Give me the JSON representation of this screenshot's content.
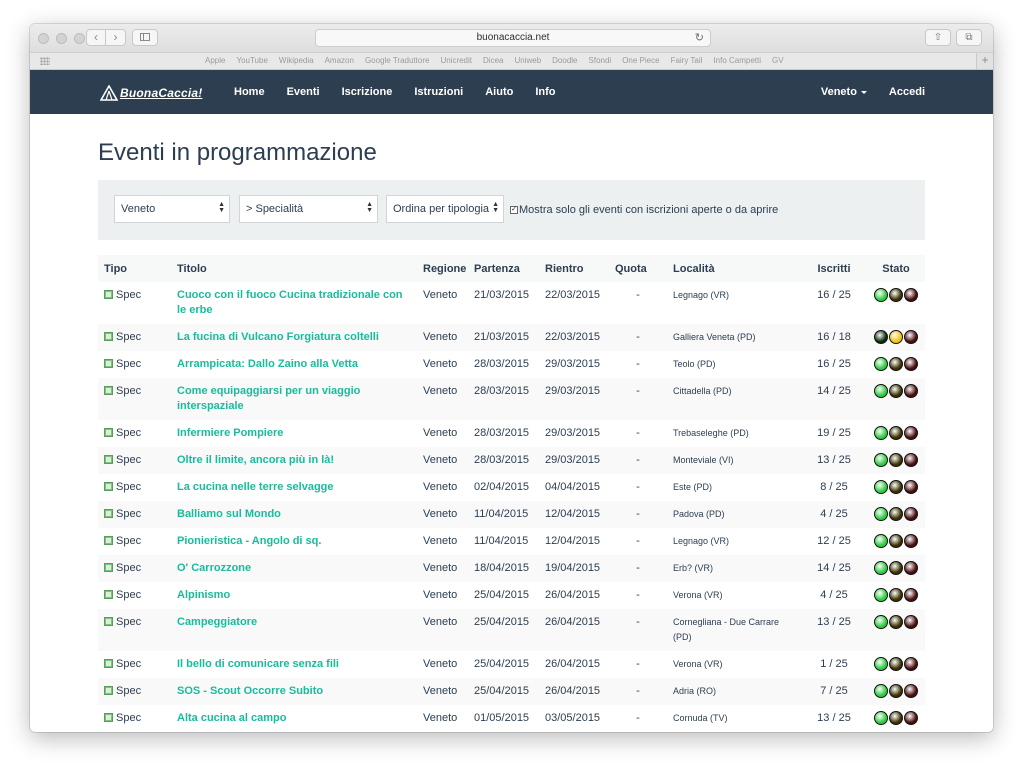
{
  "browser": {
    "url": "buonacaccia.net",
    "bookmarks": [
      "Apple",
      "YouTube",
      "Wikipedia",
      "Amazon",
      "Google Traduttore",
      "Unicredit",
      "Dicea",
      "Uniweb",
      "Doodle",
      "Sfondi",
      "One Piece",
      "Fairy Tail",
      "Info Campetti",
      "GV"
    ]
  },
  "site": {
    "logo": "BuonaCaccia!",
    "nav": [
      "Home",
      "Eventi",
      "Iscrizione",
      "Istruzioni",
      "Aiuto",
      "Info"
    ],
    "region_menu": "Veneto",
    "login": "Accedi"
  },
  "page": {
    "title": "Eventi in programmazione",
    "filters": {
      "region": "Veneto",
      "specialty": "> Specialità",
      "order": "Ordina per tipologia",
      "checkbox_label": "Mostra solo gli eventi con iscrizioni aperte o da aprire",
      "checkbox_checked": true
    },
    "columns": [
      "Tipo",
      "Titolo",
      "Regione",
      "Partenza",
      "Rientro",
      "Quota",
      "Località",
      "Iscritti",
      "Stato"
    ],
    "rows": [
      {
        "tipo": "Spec",
        "titolo": "Cuoco con il fuoco Cucina tradizionale con le erbe",
        "regione": "Veneto",
        "partenza": "21/03/2015",
        "rientro": "22/03/2015",
        "quota": "-",
        "localita": "Legnago (VR)",
        "iscritti": "16 / 25",
        "stato": "green"
      },
      {
        "tipo": "Spec",
        "titolo": "La fucina di Vulcano Forgiatura coltelli",
        "regione": "Veneto",
        "partenza": "21/03/2015",
        "rientro": "22/03/2015",
        "quota": "-",
        "localita": "Galliera Veneta (PD)",
        "iscritti": "16 / 18",
        "stato": "yellow"
      },
      {
        "tipo": "Spec",
        "titolo": "Arrampicata: Dallo Zaino alla Vetta",
        "regione": "Veneto",
        "partenza": "28/03/2015",
        "rientro": "29/03/2015",
        "quota": "-",
        "localita": "Teolo (PD)",
        "iscritti": "16 / 25",
        "stato": "green"
      },
      {
        "tipo": "Spec",
        "titolo": "Come equipaggiarsi per un viaggio interspaziale",
        "regione": "Veneto",
        "partenza": "28/03/2015",
        "rientro": "29/03/2015",
        "quota": "-",
        "localita": "Cittadella (PD)",
        "iscritti": "14 / 25",
        "stato": "green"
      },
      {
        "tipo": "Spec",
        "titolo": "Infermiere Pompiere",
        "regione": "Veneto",
        "partenza": "28/03/2015",
        "rientro": "29/03/2015",
        "quota": "-",
        "localita": "Trebaseleghe (PD)",
        "iscritti": "19 / 25",
        "stato": "green"
      },
      {
        "tipo": "Spec",
        "titolo": "Oltre il limite, ancora più in là!",
        "regione": "Veneto",
        "partenza": "28/03/2015",
        "rientro": "29/03/2015",
        "quota": "-",
        "localita": "Monteviale (VI)",
        "iscritti": "13 / 25",
        "stato": "green"
      },
      {
        "tipo": "Spec",
        "titolo": "La cucina nelle terre selvagge",
        "regione": "Veneto",
        "partenza": "02/04/2015",
        "rientro": "04/04/2015",
        "quota": "-",
        "localita": "Este (PD)",
        "iscritti": "8 / 25",
        "stato": "green"
      },
      {
        "tipo": "Spec",
        "titolo": "Balliamo sul Mondo",
        "regione": "Veneto",
        "partenza": "11/04/2015",
        "rientro": "12/04/2015",
        "quota": "-",
        "localita": "Padova (PD)",
        "iscritti": "4 / 25",
        "stato": "green"
      },
      {
        "tipo": "Spec",
        "titolo": "Pionieristica - Angolo di sq.",
        "regione": "Veneto",
        "partenza": "11/04/2015",
        "rientro": "12/04/2015",
        "quota": "-",
        "localita": "Legnago (VR)",
        "iscritti": "12 / 25",
        "stato": "green"
      },
      {
        "tipo": "Spec",
        "titolo": "O' Carrozzone",
        "regione": "Veneto",
        "partenza": "18/04/2015",
        "rientro": "19/04/2015",
        "quota": "-",
        "localita": "Erb? (VR)",
        "iscritti": "14 / 25",
        "stato": "green"
      },
      {
        "tipo": "Spec",
        "titolo": "Alpinismo",
        "regione": "Veneto",
        "partenza": "25/04/2015",
        "rientro": "26/04/2015",
        "quota": "-",
        "localita": "Verona (VR)",
        "iscritti": "4 / 25",
        "stato": "green"
      },
      {
        "tipo": "Spec",
        "titolo": "Campeggiatore",
        "regione": "Veneto",
        "partenza": "25/04/2015",
        "rientro": "26/04/2015",
        "quota": "-",
        "localita": "Cornegliana - Due Carrare (PD)",
        "iscritti": "13 / 25",
        "stato": "green"
      },
      {
        "tipo": "Spec",
        "titolo": "Il bello di comunicare senza fili",
        "regione": "Veneto",
        "partenza": "25/04/2015",
        "rientro": "26/04/2015",
        "quota": "-",
        "localita": "Verona (VR)",
        "iscritti": "1 / 25",
        "stato": "green"
      },
      {
        "tipo": "Spec",
        "titolo": "SOS - Scout Occorre Subito",
        "regione": "Veneto",
        "partenza": "25/04/2015",
        "rientro": "26/04/2015",
        "quota": "-",
        "localita": "Adria (RO)",
        "iscritti": "7 / 25",
        "stato": "green"
      },
      {
        "tipo": "Spec",
        "titolo": "Alta cucina al campo",
        "regione": "Veneto",
        "partenza": "01/05/2015",
        "rientro": "03/05/2015",
        "quota": "-",
        "localita": "Cornuda (TV)",
        "iscritti": "13 / 25",
        "stato": "green"
      }
    ]
  },
  "colors": {
    "navbar": "#2c3e50",
    "link": "#18bc9c",
    "light_green": "#2ecc40",
    "light_yellow": "#f1c40f",
    "light_red_off": "#4a0d0d",
    "light_green_off": "#0d2a0d",
    "light_yellow_off": "#3a3000"
  },
  "icons": {
    "tipo": "specialty-badge-icon",
    "stato": "traffic-light-icon"
  }
}
